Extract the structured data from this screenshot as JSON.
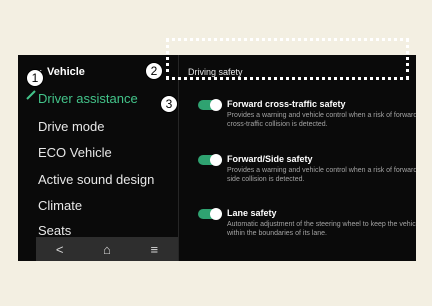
{
  "sidebar": {
    "title": "Vehicle",
    "items": [
      {
        "label": "Driver assistance",
        "active": true
      },
      {
        "label": "Drive mode",
        "active": false
      },
      {
        "label": "ECO Vehicle",
        "active": false
      },
      {
        "label": "Active sound design",
        "active": false
      },
      {
        "label": "Climate",
        "active": false
      },
      {
        "label": "Seats",
        "active": false
      }
    ]
  },
  "nav": {
    "back": "<",
    "home": "⌂",
    "menu": "≡"
  },
  "main": {
    "title": "Driving safety",
    "settings": [
      {
        "title": "Forward cross-traffic safety",
        "desc": "Provides a warning and vehicle control when a risk of forward cross-traffic collision is detected.",
        "enabled": true
      },
      {
        "title": "Forward/Side safety",
        "desc": "Provides a warning and vehicle control when a risk of forward or side collision is detected.",
        "enabled": true
      },
      {
        "title": "Lane safety",
        "desc": "Automatic adjustment of the steering wheel to keep the vehicle within the boundaries of its lane.",
        "enabled": true
      }
    ]
  },
  "callouts": [
    "1",
    "2",
    "3"
  ],
  "colors": {
    "accent": "#43c48a",
    "toggle": "#2fa371",
    "background": "#0a0a0a"
  }
}
